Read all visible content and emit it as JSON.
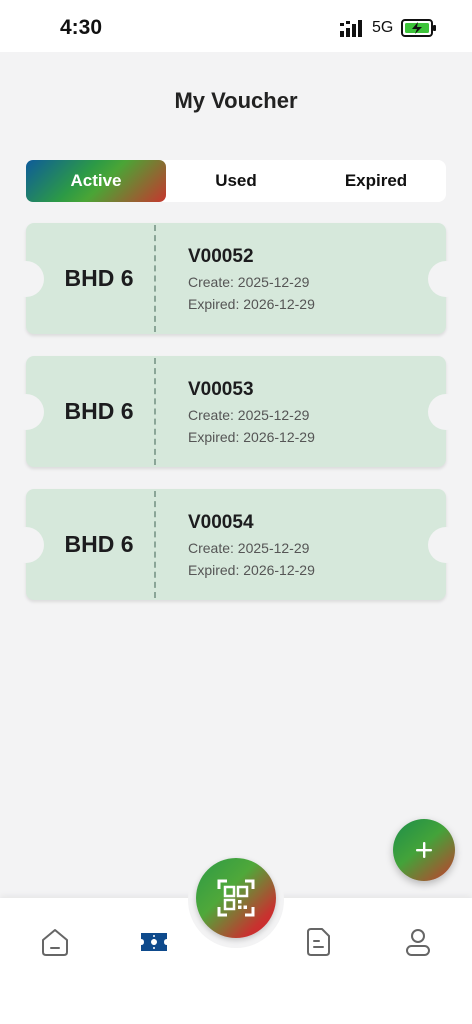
{
  "status_bar": {
    "time": "4:30",
    "network": "5G"
  },
  "page": {
    "title": "My Voucher"
  },
  "tabs": [
    {
      "label": "Active",
      "selected": true
    },
    {
      "label": "Used",
      "selected": false
    },
    {
      "label": "Expired",
      "selected": false
    }
  ],
  "vouchers": [
    {
      "amount": "BHD 6",
      "code": "V00052",
      "create": "Create: 2025-12-29",
      "expired": "Expired: 2026-12-29"
    },
    {
      "amount": "BHD 6",
      "code": "V00053",
      "create": "Create: 2025-12-29",
      "expired": "Expired: 2026-12-29"
    },
    {
      "amount": "BHD 6",
      "code": "V00054",
      "create": "Create: 2025-12-29",
      "expired": "Expired: 2026-12-29"
    }
  ],
  "bottom_nav": {
    "items": [
      {
        "icon": "home-icon",
        "selected": false
      },
      {
        "icon": "voucher-icon",
        "selected": true
      },
      {
        "icon": "qr-scan-icon",
        "selected": false
      },
      {
        "icon": "document-icon",
        "selected": false
      },
      {
        "icon": "profile-icon",
        "selected": false
      }
    ]
  },
  "colors": {
    "accent_blue": "#0e4a8c",
    "voucher_bg": "#d6e8db",
    "gradient_green": "#2c9a46",
    "gradient_red": "#c8322f"
  }
}
